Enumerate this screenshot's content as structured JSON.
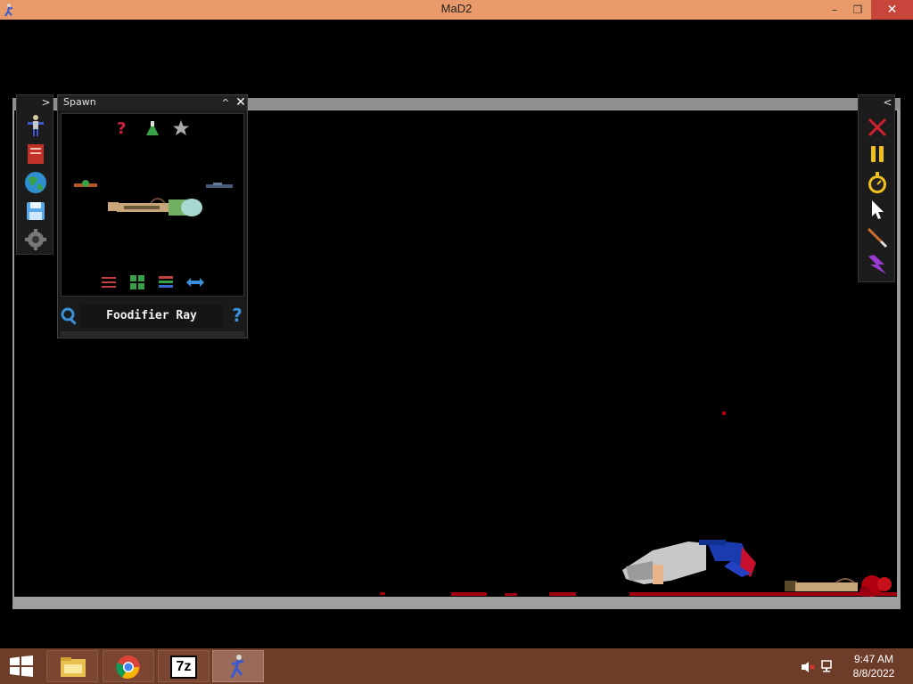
{
  "window": {
    "title": "MaD2",
    "minimize": "–",
    "restore": "❐",
    "close": "✕"
  },
  "left_toolbar": {
    "collapse": ">",
    "items": [
      "ragdoll-icon",
      "book-icon",
      "globe-icon",
      "save-icon",
      "gear-icon"
    ]
  },
  "spawn_panel": {
    "title": "Spawn",
    "up": "^",
    "close": "✕",
    "top_icons": [
      "help-icon",
      "flask-icon",
      "star-icon"
    ],
    "bottom_icons": [
      "sliders-icon",
      "grid-icon",
      "list-icon",
      "flip-icon"
    ],
    "selected_item": "Foodifier Ray",
    "help": "?"
  },
  "right_toolbar": {
    "collapse": "<",
    "items": [
      "clear-icon",
      "pause-icon",
      "stopwatch-icon",
      "cursor-icon",
      "knife-icon",
      "lightning-icon"
    ]
  },
  "taskbar": {
    "apps": [
      "file-explorer",
      "chrome",
      "7-zip",
      "MaD2"
    ],
    "seven_zip_label": "7z",
    "time": "9:47 AM",
    "date": "8/8/2022"
  },
  "colors": {
    "titlebar": "#e99a6a",
    "taskbar": "#6e3d2a",
    "frame": "#9c9c9c",
    "blood": "#b00010"
  }
}
